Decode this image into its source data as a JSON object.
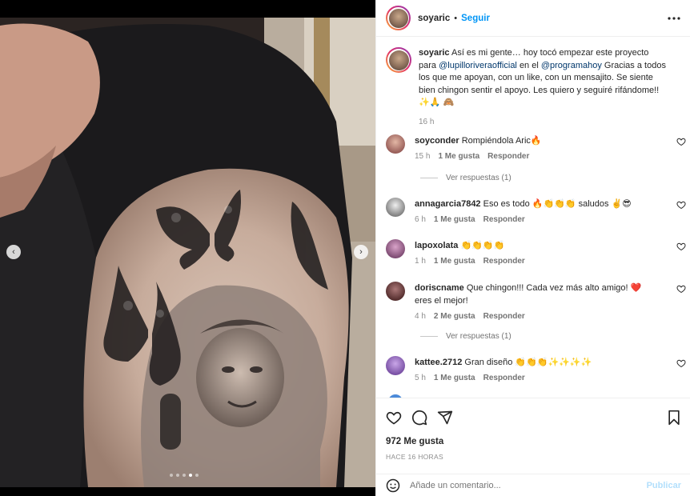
{
  "post": {
    "username": "soyaric",
    "separator": "•",
    "follow_label": "Seguir",
    "more_label": "•••"
  },
  "caption": {
    "username": "soyaric",
    "text_1": "Así es mi gente… hoy tocó empezar este proyecto para",
    "mention_1": "@lupilloriveraofficial",
    "text_2": "en el",
    "mention_2": "@programahoy",
    "text_3": "Gracias a todos los que me apoyan, con un like, con un mensajito. Se siente bien chingon sentir el apoyo. Les quiero y seguiré rifándome!! ✨🙏 🙈",
    "time": "16 h"
  },
  "comments": [
    {
      "user": "soyconder",
      "text": "Rompiéndola Aric🔥",
      "time": "15 h",
      "likes": "1 Me gusta",
      "reply": "Responder",
      "view_replies": "Ver respuestas (1)"
    },
    {
      "user": "annagarcia7842",
      "text": "Eso es todo 🔥👏👏👏 saludos ✌️😎",
      "time": "6 h",
      "likes": "1 Me gusta",
      "reply": "Responder"
    },
    {
      "user": "lapoxolata",
      "text": "👏👏👏👏",
      "time": "1 h",
      "likes": "1 Me gusta",
      "reply": "Responder"
    },
    {
      "user": "doriscname",
      "text": "Que chingon!!! Cada vez más alto amigo! ❤️ eres el mejor!",
      "time": "4 h",
      "likes": "2 Me gusta",
      "reply": "Responder",
      "view_replies": "Ver respuestas (1)"
    },
    {
      "user": "kattee.2712",
      "text": "Gran diseño 👏👏👏✨✨✨✨",
      "time": "5 h",
      "likes": "1 Me gusta",
      "reply": "Responder"
    }
  ],
  "footer": {
    "likes": "972 Me gusta",
    "ago": "HACE 16 HORAS",
    "comment_placeholder": "Añade un comentario...",
    "post_label": "Publicar"
  },
  "carousel": {
    "slides": 5,
    "current": 4
  },
  "colors": {
    "accent": "#0095f6",
    "link": "#00376b",
    "muted": "#8e8e8e",
    "post_disabled": "#b2dffc"
  },
  "icons": [
    "heart-icon",
    "comment-icon",
    "share-icon",
    "save-icon",
    "emoji-icon",
    "chevron-left-icon",
    "chevron-right-icon",
    "more-icon"
  ]
}
